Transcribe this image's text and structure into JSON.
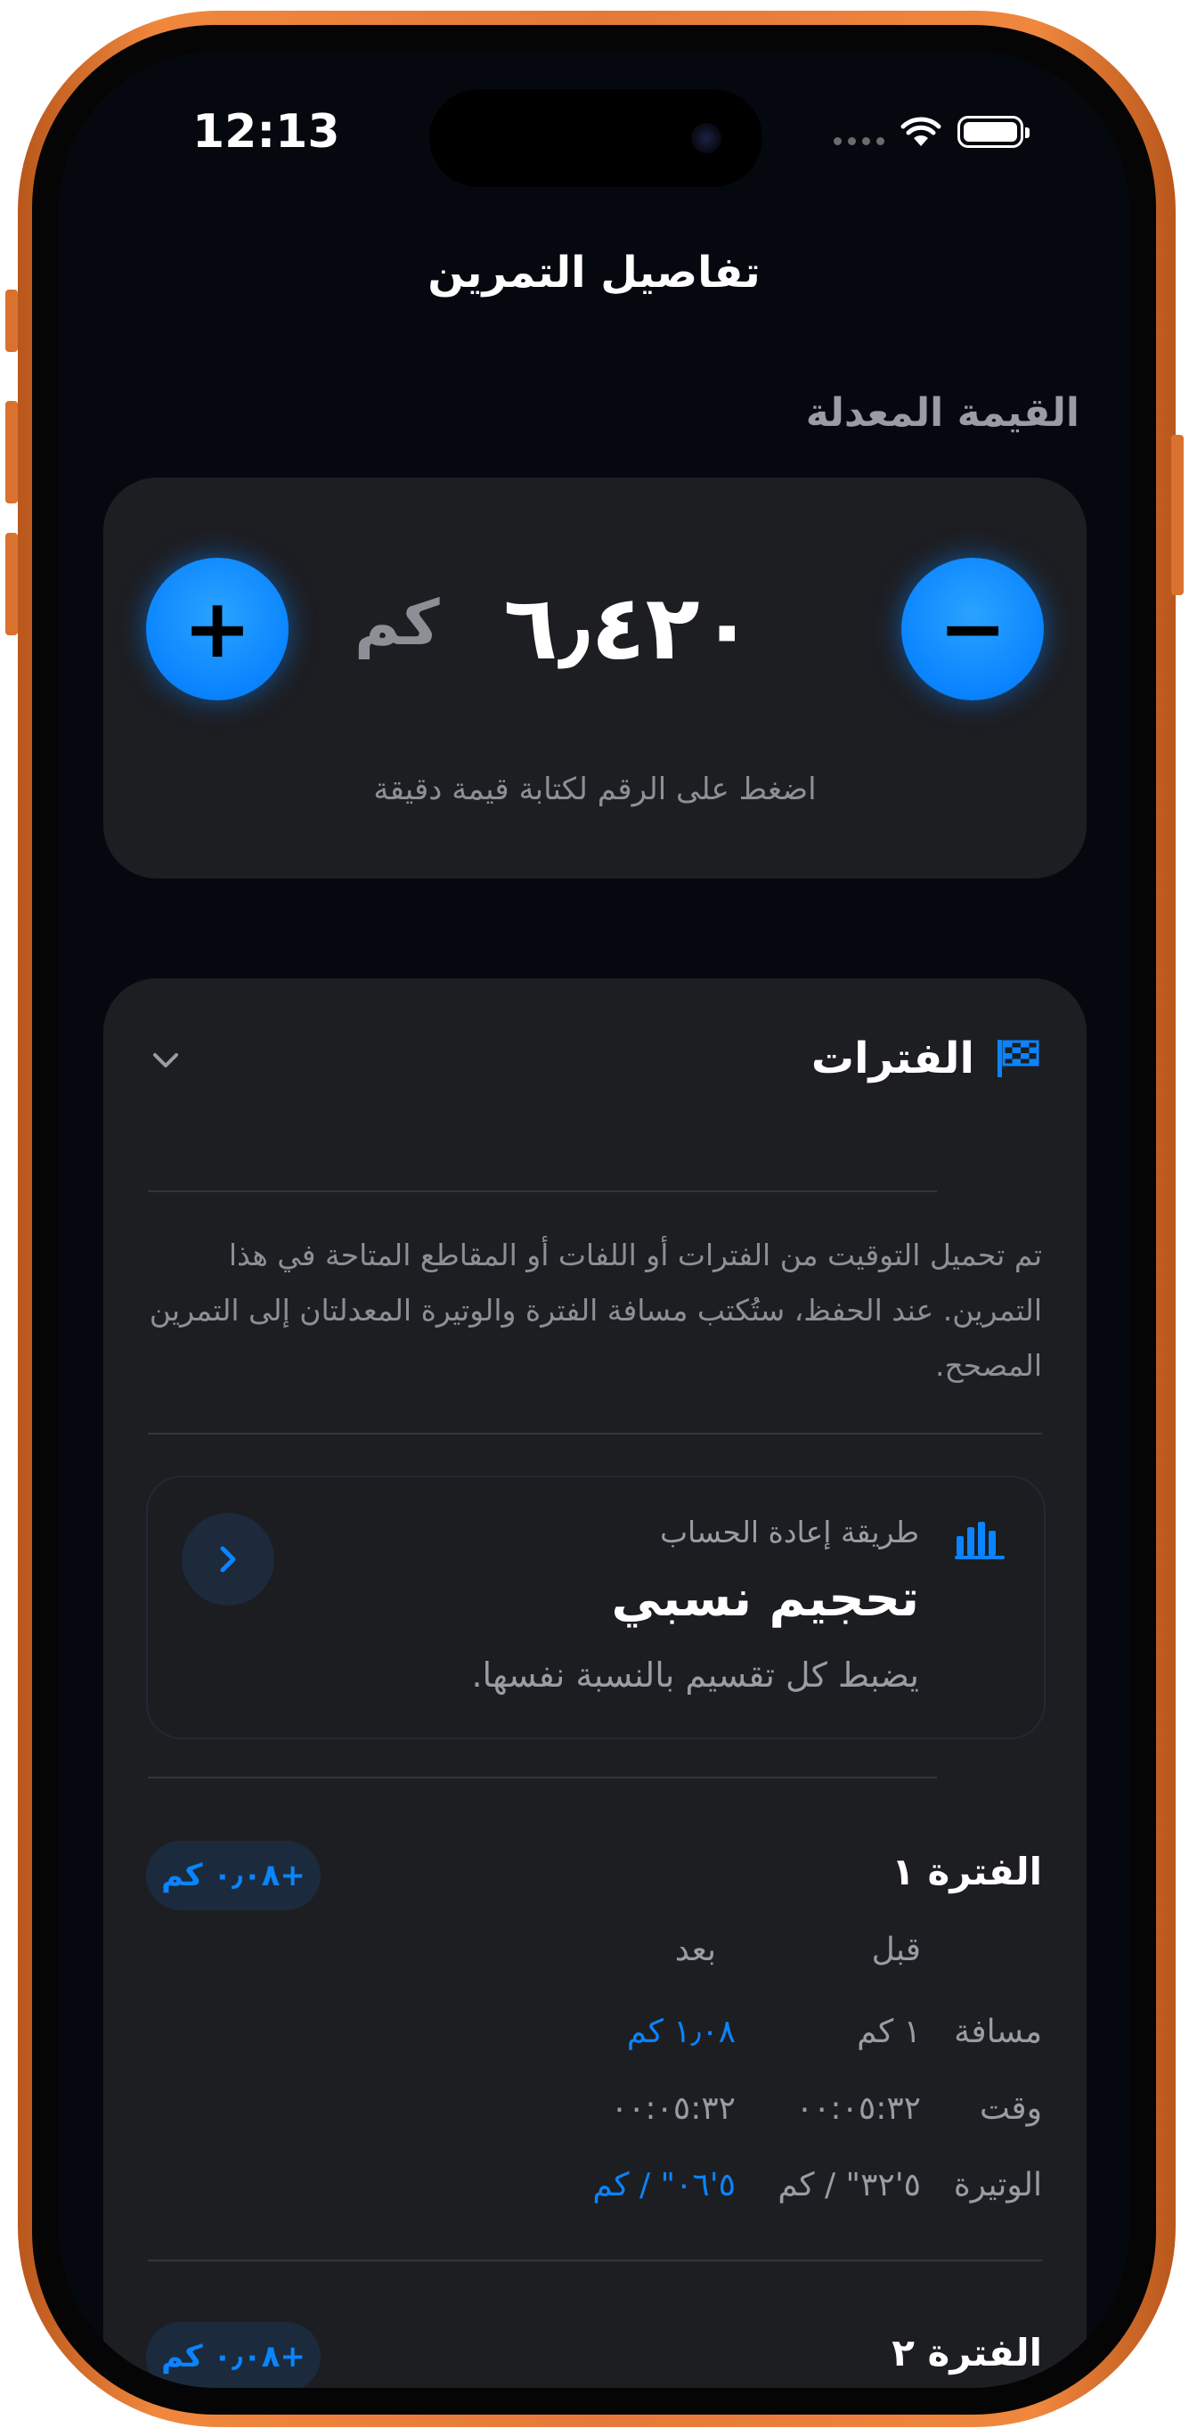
{
  "status_bar": {
    "time": "12:13"
  },
  "nav": {
    "title": "تفاصيل التمرين"
  },
  "adjusted_value": {
    "section_label": "القيمة المعدلة",
    "value": "٦٫٤٢٠",
    "unit": "كم",
    "minus_label": "−",
    "plus_label": "+",
    "hint": "اضغط على الرقم لكتابة قيمة دقيقة"
  },
  "intervals": {
    "title": "الفترات",
    "description": "تم تحميل التوقيت من الفترات أو اللفات أو المقاطع المتاحة في هذا التمرين. عند الحفظ، ستُكتب مسافة الفترة والوتيرة المعدلتان إلى التمرين المصحح.",
    "method": {
      "label": "طريقة إعادة الحساب",
      "value": "تحجيم نسبي",
      "subtitle": "يضبط كل تقسيم بالنسبة نفسها."
    },
    "columns": {
      "before": "قبل",
      "after": "بعد"
    },
    "items": [
      {
        "title": "الفترة ١",
        "delta": "+٠٫٠٨ كم",
        "rows": [
          {
            "label": "مسافة",
            "before": "١ كم",
            "after": "١٫٠٨ كم"
          },
          {
            "label": "وقت",
            "before": "٠٠:٠٥:٣٢",
            "after": "٠٠:٠٥:٣٢"
          },
          {
            "label": "الوتيرة",
            "before": "٥'٣٢\" / كم",
            "after": "٥'٠٦\" / كم"
          }
        ]
      },
      {
        "title": "الفترة ٢",
        "delta": "+٠٫٠٨ كم"
      }
    ]
  },
  "colors": {
    "accent": "#0a84ff",
    "card": "#1d1e22",
    "background": "#05090f",
    "frame": "#e5793a"
  },
  "icons": [
    "wifi-icon",
    "battery-icon",
    "flag-icon",
    "chevron-down-icon",
    "bar-chart-icon",
    "chevron-right-icon"
  ]
}
